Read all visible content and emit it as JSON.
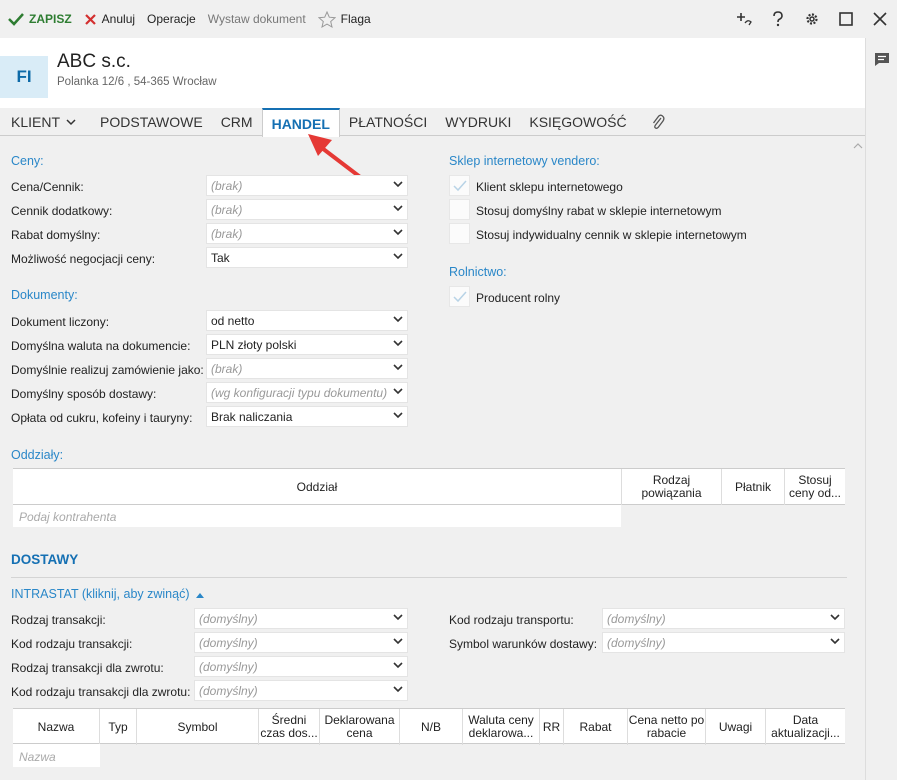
{
  "toolbar": {
    "save": "ZAPISZ",
    "cancel": "Anuluj",
    "operations": "Operacje",
    "issue_document": "Wystaw dokument",
    "flag": "Flaga"
  },
  "header": {
    "avatar": "FI",
    "company": "ABC s.c.",
    "address": "Polanka  12/6 , 54-365 Wrocław"
  },
  "tabs": [
    {
      "label": "KLIENT"
    },
    {
      "label": "PODSTAWOWE"
    },
    {
      "label": "CRM"
    },
    {
      "label": "HANDEL"
    },
    {
      "label": "PŁATNOŚCI"
    },
    {
      "label": "WYDRUKI"
    },
    {
      "label": "KSIĘGOWOŚĆ"
    }
  ],
  "ceny": {
    "title": "Ceny:",
    "rows": [
      {
        "label": "Cena/Cennik:",
        "value": "(brak)"
      },
      {
        "label": "Cennik dodatkowy:",
        "value": "(brak)"
      },
      {
        "label": "Rabat domyślny:",
        "value": "(brak)"
      },
      {
        "label": "Możliwość negocjacji ceny:",
        "value": "Tak"
      }
    ]
  },
  "dokumenty": {
    "title": "Dokumenty:",
    "rows": [
      {
        "label": "Dokument liczony:",
        "value": "od netto"
      },
      {
        "label": "Domyślna waluta na dokumencie:",
        "value": "PLN  złoty polski"
      },
      {
        "label": "Domyślnie realizuj zamówienie jako:",
        "value": "(brak)"
      },
      {
        "label": "Domyślny sposób dostawy:",
        "value": "(wg konfiguracji typu dokumentu)"
      },
      {
        "label": "Opłata od cukru, kofeiny i tauryny:",
        "value": "Brak naliczania"
      }
    ]
  },
  "sklep": {
    "title": "Sklep internetowy vendero:",
    "options": [
      {
        "label": "Klient sklepu internetowego",
        "checked": true
      },
      {
        "label": "Stosuj domyślny rabat w sklepie internetowym",
        "checked": false
      },
      {
        "label": "Stosuj indywidualny cennik w sklepie internetowym",
        "checked": false
      }
    ]
  },
  "rolnictwo": {
    "title": "Rolnictwo:",
    "options": [
      {
        "label": "Producent rolny",
        "checked": true
      }
    ]
  },
  "oddzialy": {
    "title": "Oddziały:",
    "columns": [
      "Oddział",
      "Rodzaj powiązania",
      "Płatnik",
      "Stosuj ceny od..."
    ],
    "placeholder": "Podaj kontrahenta"
  },
  "dostawy": {
    "title": "DOSTAWY",
    "intrastat": "INTRASTAT (kliknij, aby zwinąć)",
    "left": [
      {
        "label": "Rodzaj transakcji:",
        "value": "(domyślny)"
      },
      {
        "label": "Kod rodzaju transakcji:",
        "value": "(domyślny)"
      },
      {
        "label": "Rodzaj transakcji dla zwrotu:",
        "value": "(domyślny)"
      },
      {
        "label": "Kod rodzaju transakcji dla zwrotu:",
        "value": "(domyślny)"
      }
    ],
    "right": [
      {
        "label": "Kod rodzaju transportu:",
        "value": "(domyślny)"
      },
      {
        "label": "Symbol warunków dostawy:",
        "value": "(domyślny)"
      }
    ],
    "columns": [
      "Nazwa",
      "Typ",
      "Symbol",
      "Średni czas dos...",
      "Deklarowana cena",
      "N/B",
      "Waluta ceny deklarowa...",
      "RR",
      "Rabat",
      "Cena netto po rabacie",
      "Uwagi",
      "Data aktualizacji..."
    ],
    "placeholder": "Nazwa"
  },
  "colors": {
    "accent": "#1570b3",
    "section": "#2a87c8",
    "save": "#2e7d32",
    "cancel": "#d32f2f",
    "arrow": "#e53935"
  }
}
